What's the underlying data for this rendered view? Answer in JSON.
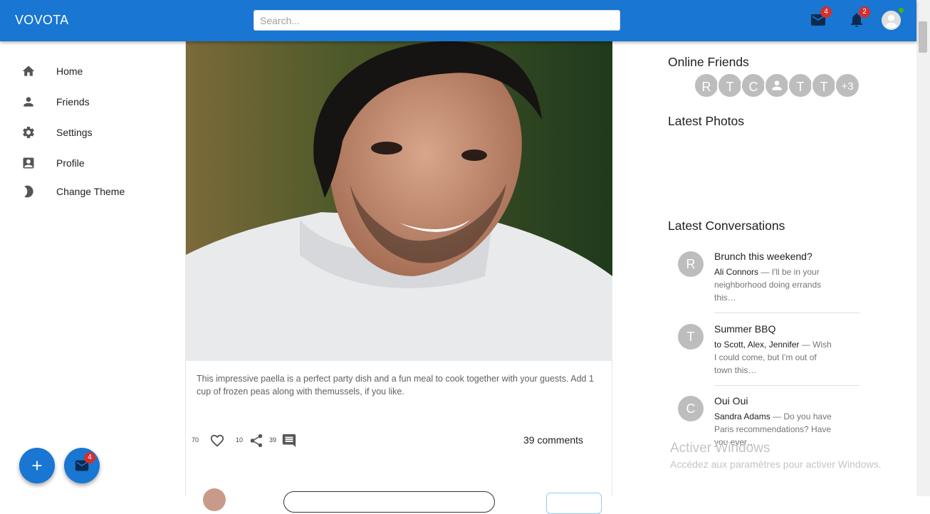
{
  "app": {
    "brand": "VOVOTA"
  },
  "search": {
    "placeholder": "Search..."
  },
  "header": {
    "mail_badge": "4",
    "notifications_badge": "2",
    "accent": "#1976d2",
    "badge_color": "#d32f2f",
    "online_color": "#44b700"
  },
  "sidebar": {
    "items": [
      {
        "label": "Home",
        "icon": "home-icon"
      },
      {
        "label": "Friends",
        "icon": "person-icon"
      },
      {
        "label": "Settings",
        "icon": "gear-icon"
      },
      {
        "label": "Profile",
        "icon": "profile-card-icon"
      },
      {
        "label": "Change Theme",
        "icon": "moon-icon"
      }
    ]
  },
  "fabs": {
    "add_icon": "plus-icon",
    "mail_icon": "mail-icon",
    "mail_badge": "4"
  },
  "post": {
    "caption": "This impressive paella is a perfect party dish and a fun meal to cook together with your guests. Add 1 cup of frozen peas along with themussels, if you like.",
    "likes": "70",
    "shares": "10",
    "comment_count_small": "39",
    "comments_link": "39 comments"
  },
  "right": {
    "online_friends_title": "Online Friends",
    "online_friends": [
      "R",
      "T",
      "C",
      "",
      "T",
      "T",
      "+3"
    ],
    "latest_photos_title": "Latest Photos",
    "latest_conversations_title": "Latest Conversations",
    "conversations": [
      {
        "initial": "R",
        "title": "Brunch this weekend?",
        "from": "Ali Connors",
        "text": " — I'll be in your neighborhood doing errands this…"
      },
      {
        "initial": "T",
        "title": "Summer BBQ",
        "from": "to Scott, Alex, Jennifer",
        "text": " — Wish I could come, but I'm out of town this…"
      },
      {
        "initial": "C",
        "title": "Oui Oui",
        "from": "Sandra Adams",
        "text": " — Do you have Paris recommendations? Have you ever…"
      }
    ]
  },
  "watermark": {
    "line1": "Activer Windows",
    "line2": "Accédez aux paramètres pour activer Windows."
  }
}
